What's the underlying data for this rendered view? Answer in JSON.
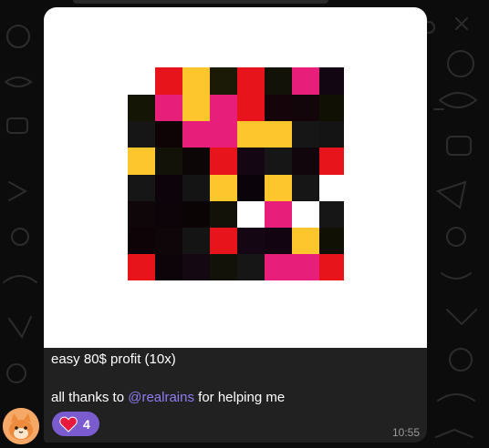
{
  "message": {
    "caption_line1": "easy 80$ profit (10x)",
    "caption_prefix": "all thanks to ",
    "mention": "@realrains",
    "caption_suffix": " for helping me",
    "time": "10:55"
  },
  "reaction": {
    "emoji": "heart-icon",
    "count": "4",
    "color": "#7b5ccf"
  },
  "colors": {
    "accent": "#8e7df1",
    "bubble": "#212121",
    "background": "#0c0c0c"
  }
}
